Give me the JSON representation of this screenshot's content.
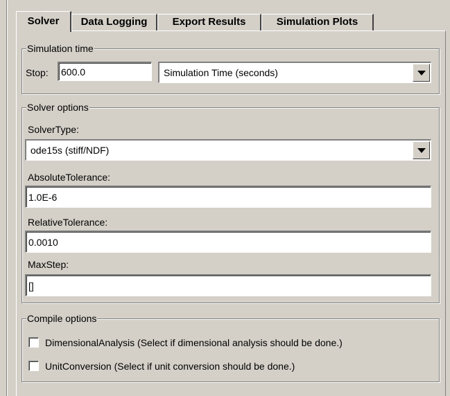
{
  "tabs": [
    {
      "label": "Solver",
      "active": true
    },
    {
      "label": "Data Logging",
      "active": false
    },
    {
      "label": "Export Results",
      "active": false
    },
    {
      "label": "Simulation Plots",
      "active": false
    }
  ],
  "simulation_time": {
    "legend": "Simulation time",
    "stop_label": "Stop:",
    "stop_value": "600.0",
    "units_selected": "Simulation Time (seconds)"
  },
  "solver_options": {
    "legend": "Solver options",
    "solver_type_label": "SolverType:",
    "solver_type_selected": "ode15s (stiff/NDF)",
    "abs_tol_label": "AbsoluteTolerance:",
    "abs_tol_value": "1.0E-6",
    "rel_tol_label": "RelativeTolerance:",
    "rel_tol_value": "0.0010",
    "max_step_label": "MaxStep:",
    "max_step_value": "[]"
  },
  "compile_options": {
    "legend": "Compile options",
    "dimensional_analysis_label": "DimensionalAnalysis (Select if dimensional analysis should be done.)",
    "dimensional_analysis_checked": false,
    "unit_conversion_label": "UnitConversion (Select if unit conversion should be done.)",
    "unit_conversion_checked": false
  }
}
